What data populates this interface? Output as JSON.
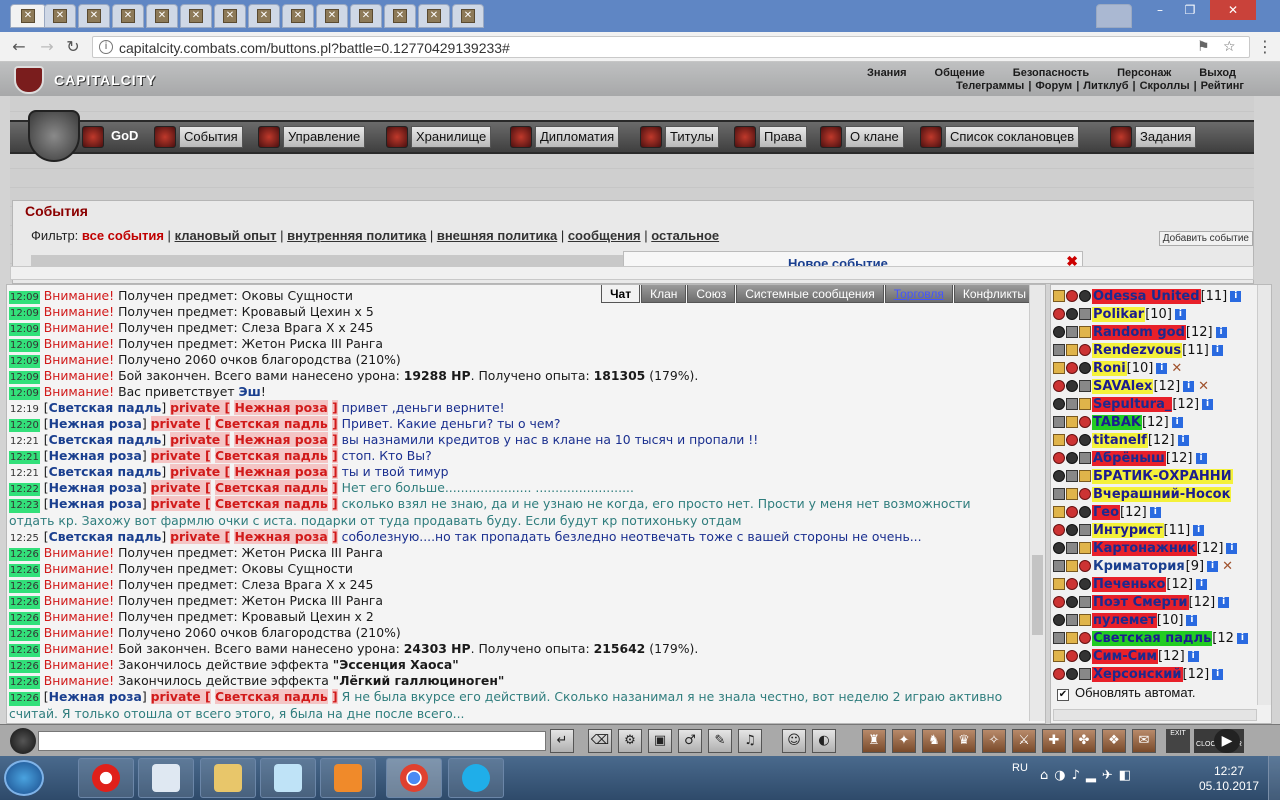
{
  "browser": {
    "tabs_count": 14,
    "url": "capitalcity.combats.com/buttons.pl?battle=0.12770429139233#"
  },
  "site": {
    "logo_text": "CAPITALCITY",
    "top_menu": [
      "Знания",
      "Общение",
      "Безопасность",
      "Персонаж",
      "Выход"
    ],
    "sub_menu": [
      "Телеграммы",
      "Форум",
      "Литклуб",
      "Скроллы",
      "Рейтинг"
    ],
    "sub_sep": "|"
  },
  "clan_nav": {
    "god": "GoD",
    "items": [
      "События",
      "Управление",
      "Хранилище",
      "Дипломатия",
      "Титулы",
      "Права",
      "О клане",
      "Список соклановцев",
      "Задания"
    ]
  },
  "events": {
    "title": "События",
    "filter_label": "Фильтр:",
    "filters": [
      "все события",
      "клановый опыт",
      "внутренняя политика",
      "внешняя политика",
      "сообщения",
      "остальное"
    ],
    "sep": "|",
    "add_button": "Добавить событие",
    "new_event": "Новое событие",
    "close": "✖"
  },
  "chat": {
    "tabs": [
      "Чат",
      "Клан",
      "Союз",
      "Системные сообщения",
      "Торговля",
      "Конфликты"
    ],
    "warn": "Внимание!",
    "lbr": "[",
    "rbr": "]",
    "private_open": "private [",
    "private_close": "]",
    "lines": [
      {
        "time": "12:09",
        "text": "Получен предмет: Оковы Сущности"
      },
      {
        "time": "12:09",
        "text": "Получен предмет: Кровавый Цехин x 5"
      },
      {
        "time": "12:09",
        "text": "Получен предмет: Слеза Врага X x 245"
      },
      {
        "time": "12:09",
        "text": "Получен предмет: Жетон Риска III Ранга"
      },
      {
        "time": "12:09",
        "text": "Получено 2060 очков благородства (210%)"
      },
      {
        "time": "12:09",
        "text1": "Бой закончен. Всего вами нанесено урона:",
        "dmg": "19288 HP",
        "text2": ". Получено опыта:",
        "exp": "181305",
        "text3": "(179%)."
      },
      {
        "time": "12:09",
        "text": "Вас приветствует",
        "who": "Эш",
        "tail": "!"
      },
      {
        "time": "12:19",
        "from": "Светская падль",
        "to": "Нежная роза",
        "msg": "привет ,деньги верните!"
      },
      {
        "time": "12:20",
        "from": "Нежная роза",
        "to": "Светская падль",
        "msg": "Привет. Какие деньги? ты о чем?"
      },
      {
        "time": "12:21",
        "from": "Светская падль",
        "to": "Нежная роза",
        "msg": "вы назнамили кредитов у нас в клане на 10 тысяч и пропали !!"
      },
      {
        "time": "12:21",
        "from": "Нежная роза",
        "to": "Светская падль",
        "msg": "стоп. Кто Вы?"
      },
      {
        "time": "12:21",
        "from": "Светская падль",
        "to": "Нежная роза",
        "msg": "ты и твой тимур"
      },
      {
        "time": "12:22",
        "from": "Нежная роза",
        "to": "Светская падль",
        "msg": "Нет его больше...................... ........................."
      },
      {
        "time": "12:23",
        "from": "Нежная роза",
        "to": "Светская падль",
        "msg": "сколько взял не знаю, да и не узнаю не когда, его просто нет. Прости у меня нет возможности отдать кр. Захожу вот фармлю очки с иста. подарки от туда продавать буду. Если будут кр потихоньку отдам"
      },
      {
        "time": "12:25",
        "from": "Светская падль",
        "to": "Нежная роза",
        "msg": "соболезную....но так пропадать безледно неотвечать тоже с вашей стороны не очень..."
      },
      {
        "time": "12:26",
        "text": "Получен предмет: Жетон Риска III Ранга"
      },
      {
        "time": "12:26",
        "text": "Получен предмет: Оковы Сущности"
      },
      {
        "time": "12:26",
        "text": "Получен предмет: Слеза Врага X x 245"
      },
      {
        "time": "12:26",
        "text": "Получен предмет: Жетон Риска III Ранга"
      },
      {
        "time": "12:26",
        "text": "Получен предмет: Кровавый Цехин x 2"
      },
      {
        "time": "12:26",
        "text": "Получено 2060 очков благородства (210%)"
      },
      {
        "time": "12:26",
        "text1": "Бой закончен. Всего вами нанесено урона:",
        "dmg": "24303 HP",
        "text2": ". Получено опыта:",
        "exp": "215642",
        "text3": "(179%)."
      },
      {
        "time": "12:26",
        "text1": "Закончилось действие эффекта",
        "effect": "\"Эссенция Хаоса\""
      },
      {
        "time": "12:26",
        "text1": "Закончилось действие эффекта",
        "effect": "\"Лёгкий галлюциноген\""
      },
      {
        "time": "12:26",
        "from": "Нежная роза",
        "to": "Светская падль",
        "msg": "Я не была вкурсе его действий. Сколько назанимал я не знала честно, вот неделю 2 играю активно считай. Я только отошла от всего этого, я была на дне после всего..."
      }
    ]
  },
  "online": {
    "users": [
      {
        "nick": "Odessa United",
        "level": "[11]",
        "bg": "red",
        "sword": false
      },
      {
        "nick": "Polikar",
        "level": "[10]",
        "bg": "yel",
        "sword": false
      },
      {
        "nick": "Random god",
        "level": "[12]",
        "bg": "red",
        "sword": false
      },
      {
        "nick": "Rendezvous",
        "level": "[11]",
        "bg": "yel",
        "sword": false
      },
      {
        "nick": "Roni",
        "level": "[10]",
        "bg": "yel",
        "sword": true
      },
      {
        "nick": "SAVAlex",
        "level": "[12]",
        "bg": "yel",
        "sword": true
      },
      {
        "nick": "Sepultura_",
        "level": "[12]",
        "bg": "red",
        "sword": false
      },
      {
        "nick": "TABAK",
        "level": "[12]",
        "bg": "grn",
        "sword": false
      },
      {
        "nick": "titanelf",
        "level": "[12]",
        "bg": "yel",
        "sword": false
      },
      {
        "nick": "Абрёныш",
        "level": "[12]",
        "bg": "red",
        "sword": false
      },
      {
        "nick": "БРАТИК-ОХРАННИ",
        "level": "",
        "bg": "yel",
        "sword": false
      },
      {
        "nick": "Вчерашний-Носок",
        "level": "",
        "bg": "yel",
        "sword": false
      },
      {
        "nick": "Гео",
        "level": "[12]",
        "bg": "red",
        "sword": false
      },
      {
        "nick": "Интурист",
        "level": "[11]",
        "bg": "yel",
        "sword": false
      },
      {
        "nick": "Картонажник",
        "level": "[12]",
        "bg": "red",
        "sword": false
      },
      {
        "nick": "Криматория",
        "level": "[9]",
        "bg": "none",
        "sword": true
      },
      {
        "nick": "Печенько",
        "level": "[12]",
        "bg": "red",
        "sword": false
      },
      {
        "nick": "Поэт Смерти",
        "level": "[12]",
        "bg": "red",
        "sword": false
      },
      {
        "nick": "пулемет",
        "level": "[10]",
        "bg": "red",
        "sword": false
      },
      {
        "nick": "Светская падль",
        "level": "[12",
        "bg": "grn",
        "sword": false
      },
      {
        "nick": "Сим-Сим",
        "level": "[12]",
        "bg": "red",
        "sword": false
      },
      {
        "nick": "Херсонский",
        "level": "[12]",
        "bg": "red",
        "sword": false
      }
    ],
    "info_glyph": "i",
    "sword_glyph": "✕",
    "auto_update": "Обновлять автомат."
  },
  "toolbar": {
    "exit": "EXIT",
    "clock_label": "CLOCKTIMER"
  },
  "taskbar": {
    "lang": "RU",
    "time": "12:27",
    "date": "05.10.2017"
  }
}
